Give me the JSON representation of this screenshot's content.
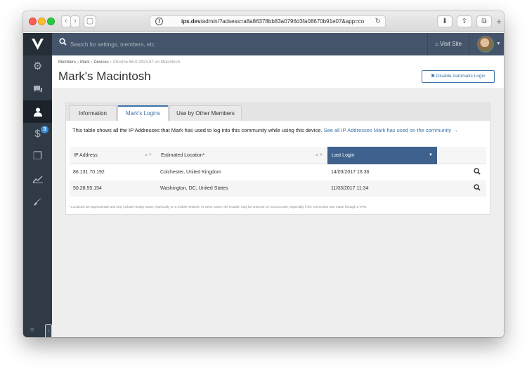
{
  "browser": {
    "url_host": "ips.dev",
    "url_path": "/admin/?adsess=a8a86378bb83a0796d3fa08670b91e07&app=co",
    "nav_back": "‹",
    "nav_forward": "›"
  },
  "topbar": {
    "search_placeholder": "Search for settings, members, etc.",
    "visit_site_label": "Visit Site"
  },
  "sidebar": {
    "items": [
      {
        "name": "settings",
        "icon": "⚙"
      },
      {
        "name": "chat",
        "icon": "💬"
      },
      {
        "name": "members",
        "icon": "👤"
      },
      {
        "name": "commerce",
        "icon": "$",
        "badge": "3"
      },
      {
        "name": "pages",
        "icon": "❐"
      },
      {
        "name": "stats",
        "icon": "📈"
      },
      {
        "name": "customize",
        "icon": "🖌"
      }
    ]
  },
  "header": {
    "breadcrumbs": [
      "Members",
      "Mark",
      "Devices",
      "Chrome 56.0.2924.87 on Macintosh"
    ],
    "title": "Mark's Macintosh",
    "disable_button": "Disable Automatic Login"
  },
  "tabs": [
    {
      "label": "Information",
      "active": false
    },
    {
      "label": "Mark's Logins",
      "active": true
    },
    {
      "label": "Use by Other Members",
      "active": false
    }
  ],
  "intro": {
    "text": "This table shows all the IP Addresses that Mark has used to log into this community while using this device.",
    "link": "See all IP Addresses Mark has used on the community →"
  },
  "table": {
    "columns": [
      "IP Address",
      "Estimated Location*",
      "Last Login"
    ],
    "rows": [
      {
        "ip": "86.131.70.192",
        "location": "Colchester, United Kingdom",
        "last_login": "14/03/2017 16:36"
      },
      {
        "ip": "50.28.55.154",
        "location": "Washington, DC, United States",
        "last_login": "11/03/2017 11:34"
      }
    ],
    "footnote": "* Locations are approximate and may include nearby towns, especially on a mobile network. In some cases, the location may be unknown or not accurate, especially if the connection was made through a VPN."
  },
  "colors": {
    "topbar": "#44546a",
    "sidebar": "#2f3a46",
    "accent": "#3c73a8",
    "sorted_header": "#3f618e"
  }
}
